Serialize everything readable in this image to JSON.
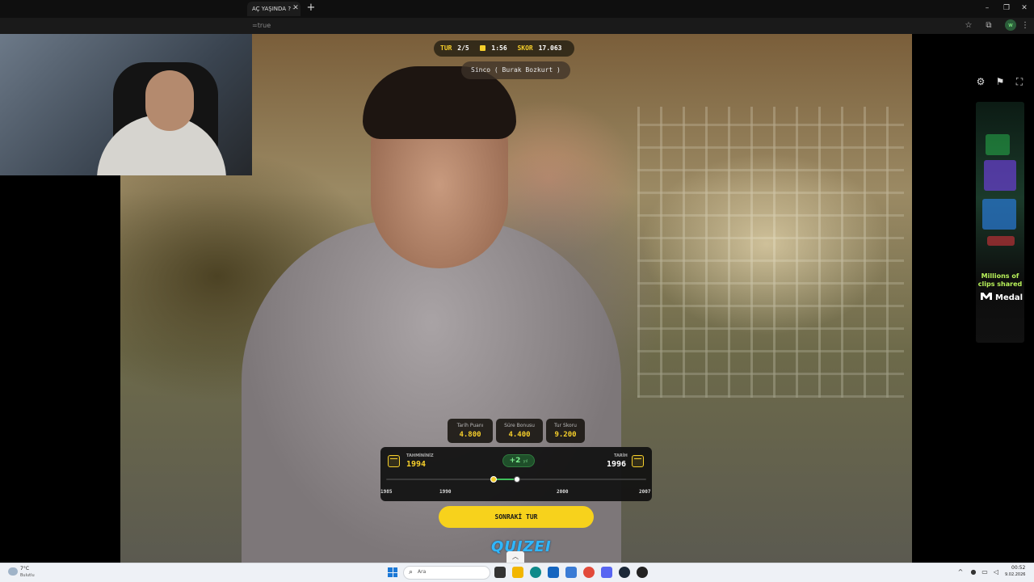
{
  "browser": {
    "tab_title": "AÇ YAŞINDA ? - ",
    "tab_close": "✕",
    "new_tab": "+",
    "url": "=true",
    "window_controls": [
      "–",
      "❐",
      "✕"
    ]
  },
  "hud": {
    "round_label": "TUR",
    "round_value": "2/5",
    "time_value": "1:56",
    "score_label": "SKOR",
    "score_value": "17.063",
    "person_name": "Sinco ( Burak Bozkurt )"
  },
  "score_cards": [
    {
      "label": "Tarih Puanı",
      "value": "4.800"
    },
    {
      "label": "Süre Bonusu",
      "value": "4.400"
    },
    {
      "label": "Tur Skoru",
      "value": "9.200"
    }
  ],
  "guess": {
    "guess_label": "TAHMİNİNİZ",
    "guess_value": "1994",
    "actual_label": "TARİH",
    "actual_value": "1996",
    "difference": "+2",
    "difference_unit": "yıl",
    "ticks": [
      "1985",
      "1990",
      "2000",
      "2007"
    ]
  },
  "next_button": "SONRAKİ TUR",
  "logo_text": "QUIZEI",
  "ad": {
    "text": "Millions of clips shared",
    "brand": "Medal"
  },
  "taskbar": {
    "weather_temp": "7°C",
    "weather_desc": "Bulutlu",
    "search_placeholder": "Ara",
    "time": "00:52",
    "date": "9.02.2026"
  },
  "colors": {
    "accent": "#f7d21c",
    "success": "#3fbf5a",
    "logo": "#2fb7ff"
  }
}
